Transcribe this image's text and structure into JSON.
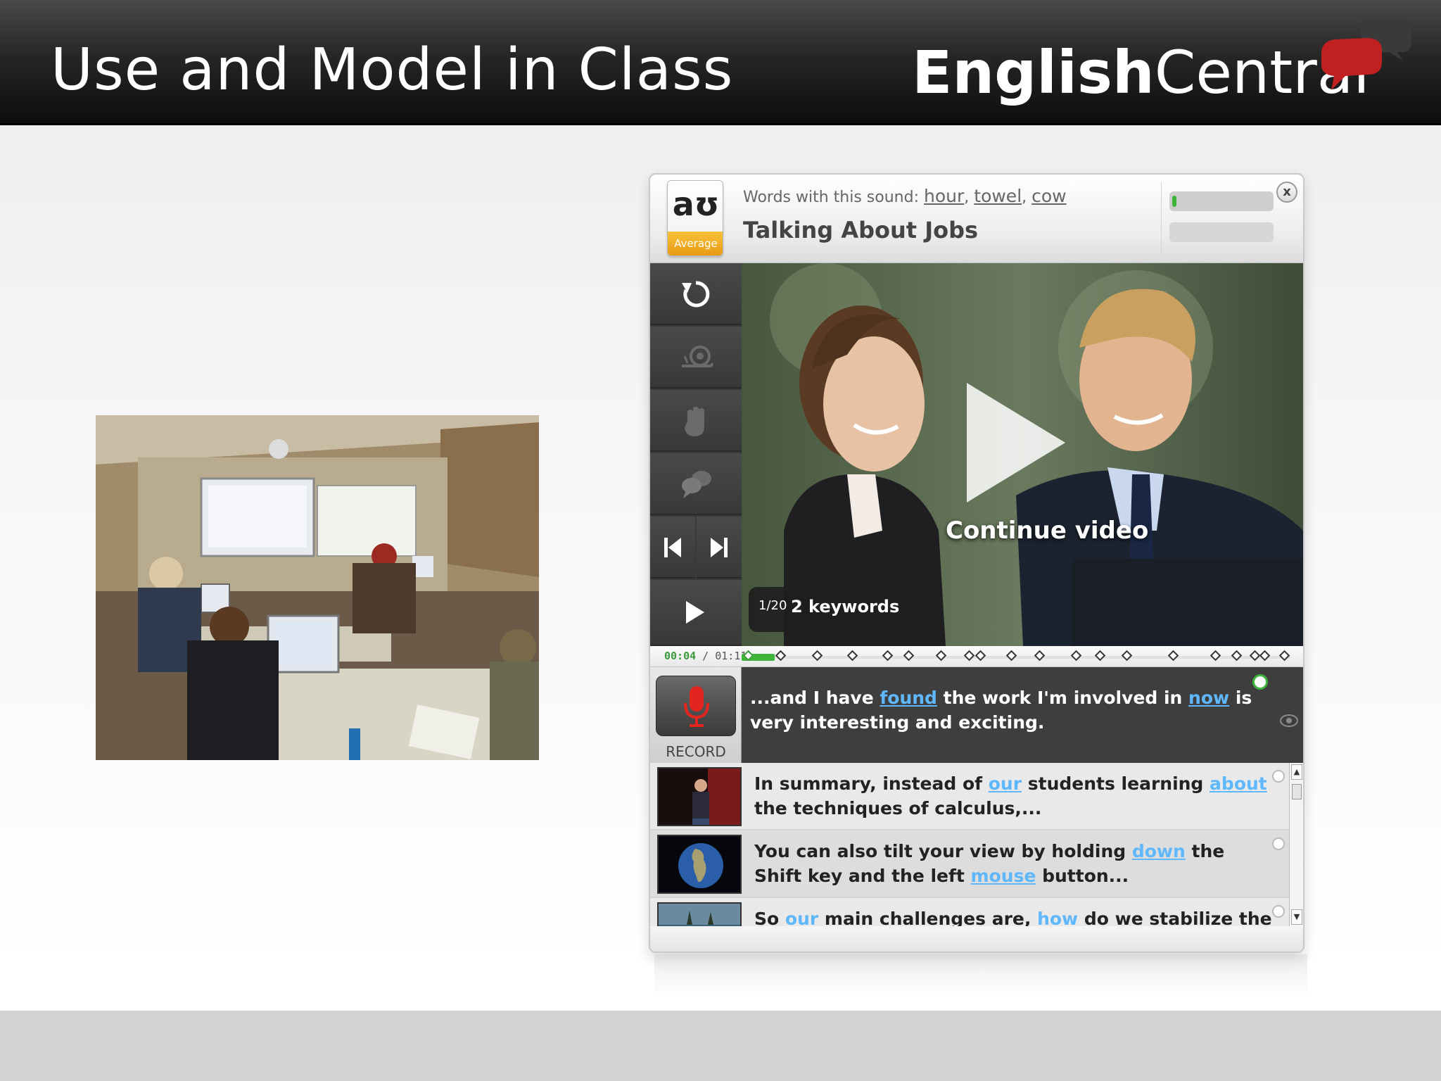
{
  "slide": {
    "title": "Use and Model in Class"
  },
  "brand": {
    "part1": "English",
    "part2": "Central",
    "color_bubble": "#c0201f"
  },
  "player": {
    "sound": {
      "symbol": "aʊ",
      "level": "Average",
      "prefix": "Words with this sound:",
      "words": [
        "hour",
        "towel",
        "cow"
      ]
    },
    "lesson_title": "Talking About Jobs",
    "close_label": "x",
    "score_progress": 0.04,
    "controls": [
      "replay-icon",
      "slow-icon",
      "hand-icon",
      "speech-bubbles-icon",
      "previous-icon",
      "next-icon",
      "play-icon"
    ],
    "video": {
      "continue_label": "Continue video",
      "line_count": "1/20",
      "keywords_label": "2 keywords"
    },
    "timeline": {
      "current": "00:04",
      "separator": " / ",
      "total": "01:11",
      "progress": 0.06
    },
    "current_line": {
      "segments": [
        {
          "text": "...and I have ",
          "kw": false
        },
        {
          "text": "found",
          "kw": true
        },
        {
          "text": " the work I'm involved in ",
          "kw": false
        },
        {
          "text": "now",
          "kw": true
        },
        {
          "text": " is very interesting and exciting.",
          "kw": false
        }
      ]
    },
    "record_label": "RECORD",
    "list": [
      {
        "thumb": "speaker-on-stage",
        "segments": [
          {
            "text": "In summary, instead of ",
            "kw": false
          },
          {
            "text": "our",
            "kw": true
          },
          {
            "text": " students learning ",
            "kw": false
          },
          {
            "text": "about",
            "kw": true
          },
          {
            "text": " the techniques of calculus,...",
            "kw": false
          }
        ]
      },
      {
        "thumb": "globe",
        "segments": [
          {
            "text": "You can also tilt your view by holding ",
            "kw": false
          },
          {
            "text": "down",
            "kw": true
          },
          {
            "text": " the Shift key and the left ",
            "kw": false
          },
          {
            "text": "mouse",
            "kw": true
          },
          {
            "text": " button...",
            "kw": false
          }
        ]
      },
      {
        "thumb": "sea-vessel",
        "segments": [
          {
            "text": "So ",
            "kw": false
          },
          {
            "text": "our",
            "kw": true
          },
          {
            "text": " main challenges are, ",
            "kw": false
          },
          {
            "text": "how",
            "kw": true
          },
          {
            "text": " do we stabilize the vessel itself in",
            "kw": false
          }
        ]
      }
    ],
    "colors": {
      "keyword": "#5fb8ff",
      "progress": "#3fb43b",
      "level_badge": "#f0a820"
    }
  }
}
